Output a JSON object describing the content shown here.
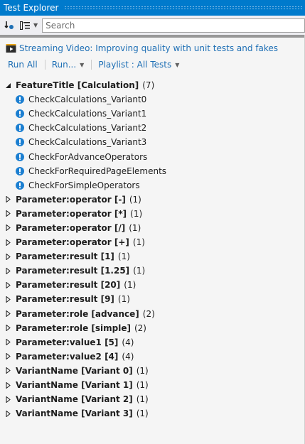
{
  "window": {
    "title": "Test Explorer"
  },
  "toolbar": {
    "group_by_icon": "group-by-icon",
    "run_filter_icon": "list-filter-icon",
    "search_placeholder": "Search"
  },
  "video_link": {
    "icon": "video-icon",
    "text": "Streaming Video: Improving quality with unit tests and fakes"
  },
  "actions": {
    "run_all": "Run All",
    "run": "Run...",
    "playlist": "Playlist : All Tests"
  },
  "tree": {
    "expanded_group": {
      "name": "FeatureTitle [Calculation]",
      "count": "(7)",
      "tests": [
        "CheckCalculations_Variant0",
        "CheckCalculations_Variant1",
        "CheckCalculations_Variant2",
        "CheckCalculations_Variant3",
        "CheckForAdvanceOperators",
        "CheckForRequiredPageElements",
        "CheckForSimpleOperators"
      ]
    },
    "collapsed_groups": [
      {
        "name": "Parameter:operator [-]",
        "count": "(1)"
      },
      {
        "name": "Parameter:operator [*]",
        "count": "(1)"
      },
      {
        "name": "Parameter:operator [/]",
        "count": "(1)"
      },
      {
        "name": "Parameter:operator [+]",
        "count": "(1)"
      },
      {
        "name": "Parameter:result [1]",
        "count": "(1)"
      },
      {
        "name": "Parameter:result [1.25]",
        "count": "(1)"
      },
      {
        "name": "Parameter:result [20]",
        "count": "(1)"
      },
      {
        "name": "Parameter:result [9]",
        "count": "(1)"
      },
      {
        "name": "Parameter:role [advance]",
        "count": "(2)"
      },
      {
        "name": "Parameter:role [simple]",
        "count": "(2)"
      },
      {
        "name": "Parameter:value1 [5]",
        "count": "(4)"
      },
      {
        "name": "Parameter:value2 [4]",
        "count": "(4)"
      },
      {
        "name": "VariantName [Variant 0]",
        "count": "(1)"
      },
      {
        "name": "VariantName [Variant 1]",
        "count": "(1)"
      },
      {
        "name": "VariantName [Variant 2]",
        "count": "(1)"
      },
      {
        "name": "VariantName [Variant 3]",
        "count": "(1)"
      }
    ]
  },
  "colors": {
    "title_bar": "#007acc",
    "link": "#1e6fb5",
    "warning_icon": "#1c7fd1"
  }
}
